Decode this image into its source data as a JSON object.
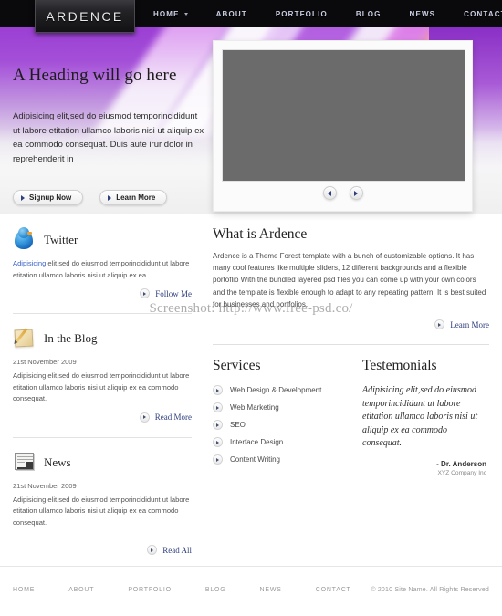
{
  "site": {
    "logo": "ARDENCE"
  },
  "nav": {
    "items": [
      {
        "label": "HOME",
        "has_dropdown": true
      },
      {
        "label": "ABOUT",
        "has_dropdown": false
      },
      {
        "label": "PORTFOLIO",
        "has_dropdown": false
      },
      {
        "label": "BLOG",
        "has_dropdown": false
      },
      {
        "label": "NEWS",
        "has_dropdown": false
      },
      {
        "label": "CONTACT",
        "has_dropdown": false
      }
    ]
  },
  "hero": {
    "heading": "A Heading will go here",
    "paragraph": "Adipisicing elit,sed do eiusmod temporincididunt ut labore etitation ullamco laboris nisi ut aliquip ex ea commodo consequat. Duis aute irur dolor in reprehenderit in",
    "primary_button": "Signup Now",
    "secondary_button": "Learn More"
  },
  "slider": {
    "prev_label": "Previous slide",
    "next_label": "Next slide",
    "placeholder_color": "#6b6b6b"
  },
  "sidebar": {
    "twitter": {
      "title": "Twitter",
      "link_text": "Adipisicing",
      "body": " elit,sed do eiusmod temporincididunt ut labore etitation ullamco laboris nisi ut aliquip ex ea",
      "more": "Follow Me"
    },
    "blog": {
      "title": "In the Blog",
      "date": "21st November 2009",
      "body": "Adipisicing elit,sed do eiusmod temporincididunt ut labore etitation ullamco laboris nisi ut aliquip ex ea commodo consequat.",
      "more": "Read More"
    },
    "news": {
      "title": "News",
      "date": "21st November 2009",
      "body": "Adipisicing elit,sed do eiusmod temporincididunt ut labore etitation ullamco laboris nisi ut aliquip ex ea commodo consequat.",
      "more": "Read All"
    }
  },
  "about": {
    "title": "What is Ardence",
    "paragraph": "Ardence is a Theme Forest template with a bunch of customizable options. It has many cool features like multiple sliders, 12 different backgrounds and a flexible portoflio With the bundled layered psd files you can come up with your own colors and the template is flexible enough to adapt to any repeating pattern. It is best suited for businesses and portfolios.",
    "more": "Learn More"
  },
  "services": {
    "title": "Services",
    "items": [
      "Web Design & Development",
      "Web Marketing",
      "SEO",
      "Interface Design",
      "Content Writing"
    ]
  },
  "testimonials": {
    "title": "Testemonials",
    "quote": "Adipisicing elit,sed do eiusmod temporincididunt ut labore etitation ullamco laboris nisi ut aliquip ex ea commodo consequat.",
    "author": "- Dr. Anderson",
    "company": "XYZ Company Inc"
  },
  "footer": {
    "links": [
      "HOME",
      "ABOUT",
      "PORTFOLIO",
      "BLOG",
      "NEWS",
      "CONTACT"
    ],
    "copyright": "© 2010 Site Name.  All Rights Reserved"
  },
  "watermark": {
    "text": "Screenshot: http://www.free-psd.co/"
  },
  "colors": {
    "nav_bg": "#0a0a0c",
    "accent_purple": "#9b3fd4",
    "link_blue": "#2f3f7e",
    "placeholder_gray": "#6b6b6b"
  }
}
